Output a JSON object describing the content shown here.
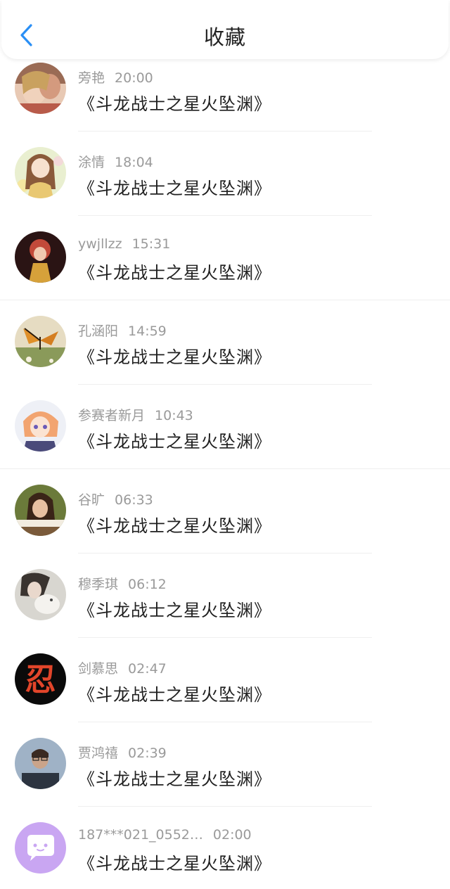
{
  "header": {
    "title": "收藏"
  },
  "items": [
    {
      "name": "旁艳",
      "time": "20:00",
      "title": "《斗龙战士之星火坠渊》",
      "avatar_icon": "couple-photo-avatar"
    },
    {
      "name": "涂情",
      "time": "18:04",
      "title": "《斗龙战士之星火坠渊》",
      "avatar_icon": "anime-girl-avatar"
    },
    {
      "name": "ywjllzz",
      "time": "15:31",
      "title": "《斗龙战士之星火坠渊》",
      "avatar_icon": "red-hair-anime-avatar"
    },
    {
      "name": "孔涵阳",
      "time": "14:59",
      "title": "《斗龙战士之星火坠渊》",
      "avatar_icon": "butterfly-avatar"
    },
    {
      "name": "参赛者新月",
      "time": "10:43",
      "title": "《斗龙战士之星火坠渊》",
      "avatar_icon": "anime-boy-avatar"
    },
    {
      "name": "谷旷",
      "time": "06:33",
      "title": "《斗龙战士之星火坠渊》",
      "avatar_icon": "girl-photo-avatar"
    },
    {
      "name": "穆季琪",
      "time": "06:12",
      "title": "《斗龙战士之星火坠渊》",
      "avatar_icon": "girl-with-cat-avatar"
    },
    {
      "name": "剑慕思",
      "time": "02:47",
      "title": "《斗龙战士之星火坠渊》",
      "avatar_icon": "ren-character-avatar",
      "avatar_text": "忍"
    },
    {
      "name": "贾鸿禧",
      "time": "02:39",
      "title": "《斗龙战士之星火坠渊》",
      "avatar_icon": "man-at-laptop-avatar"
    },
    {
      "name": "187***021_0552…",
      "time": "02:00",
      "title": "《斗龙战士之星火坠渊》",
      "avatar_icon": "chat-bubble-avatar"
    }
  ],
  "colors": {
    "accent": "#2a8ff5",
    "meta_text": "#9a9a9a",
    "title_text": "#1f1f1f",
    "default_avatar_bg": "#c9a6f2"
  }
}
